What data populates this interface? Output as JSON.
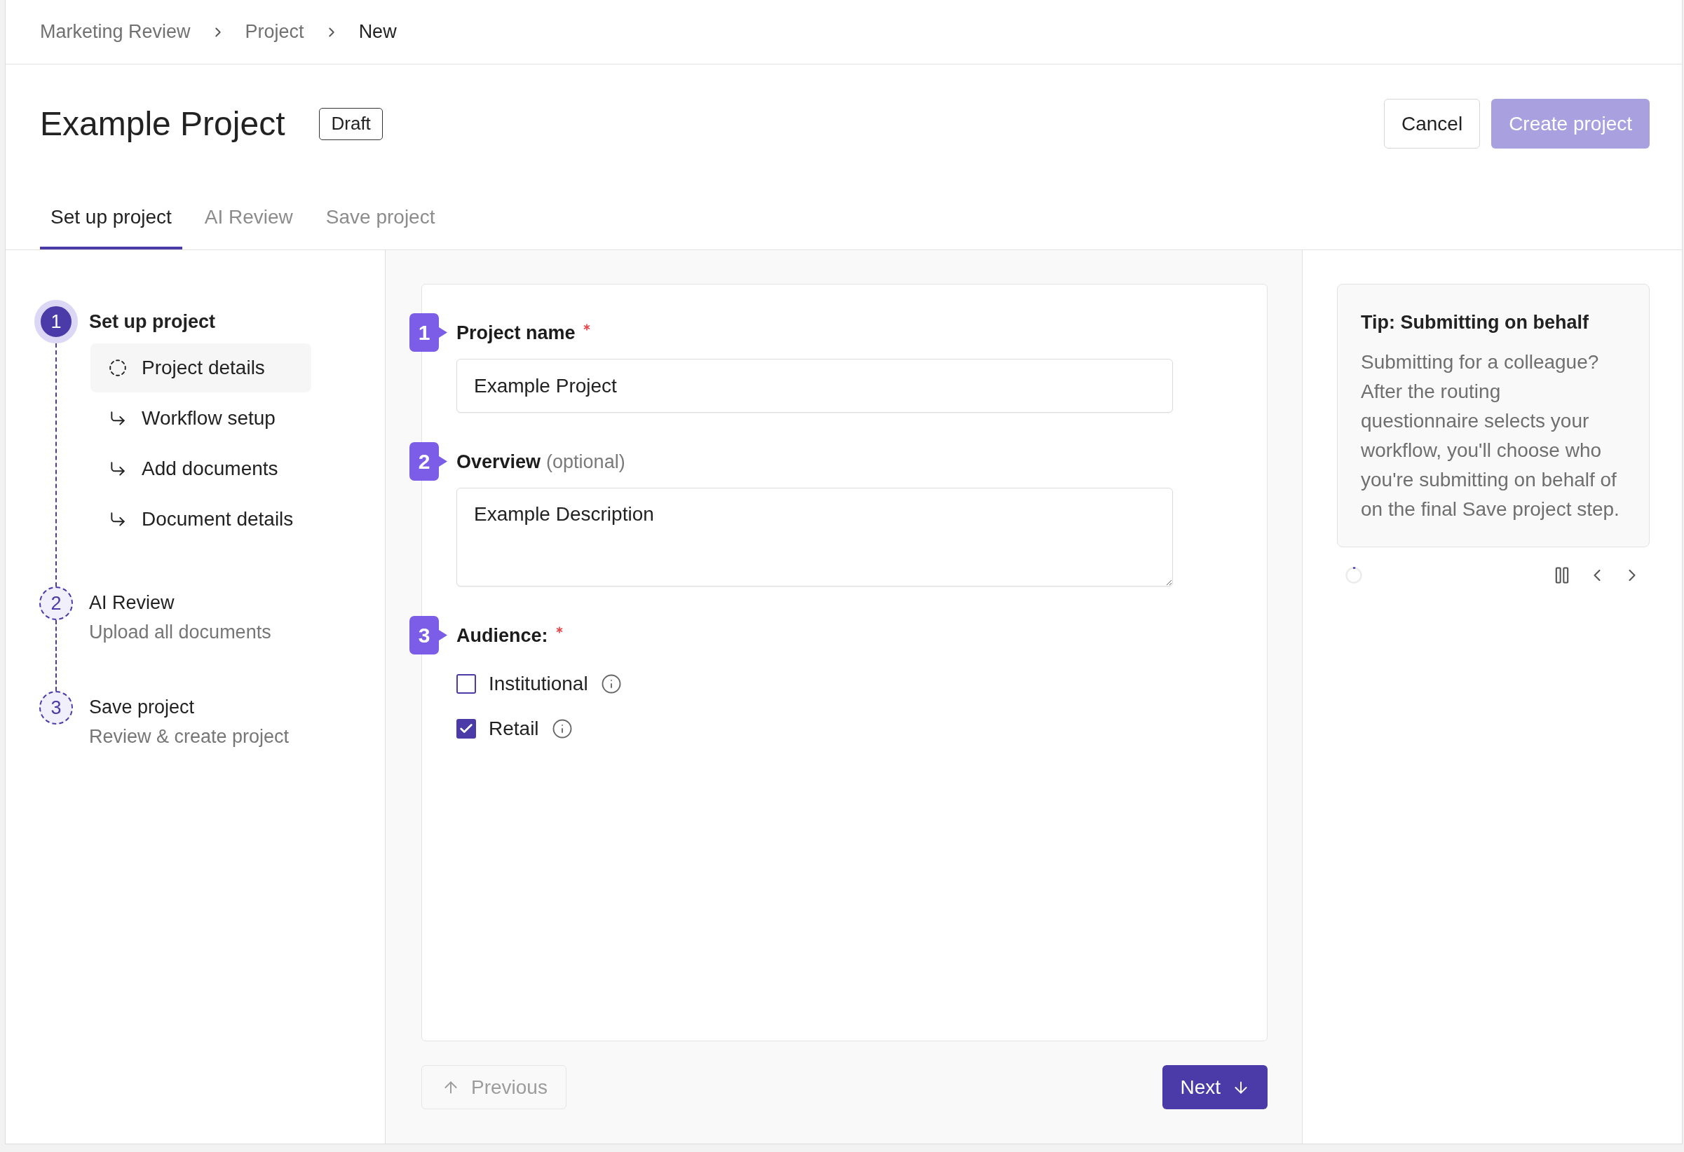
{
  "breadcrumb": [
    {
      "label": "Marketing Review",
      "current": false
    },
    {
      "label": "Project",
      "current": false
    },
    {
      "label": "New",
      "current": true
    }
  ],
  "header": {
    "title": "Example Project",
    "status_badge": "Draft",
    "buttons": [
      {
        "label": "Cancel",
        "kind": "secondary",
        "disabled": false
      },
      {
        "label": "Create project",
        "kind": "primary",
        "disabled": true
      }
    ]
  },
  "tabs": [
    {
      "label": "Set up project",
      "selected": true
    },
    {
      "label": "AI Review",
      "selected": false
    },
    {
      "label": "Save project",
      "selected": false
    }
  ],
  "steps": [
    {
      "number": "1",
      "title": "Set up project",
      "current": true,
      "substeps": [
        {
          "label": "Project details",
          "selected": true
        },
        {
          "label": "Workflow setup",
          "selected": false
        },
        {
          "label": "Add documents",
          "selected": false
        },
        {
          "label": "Document details",
          "selected": false
        }
      ]
    },
    {
      "number": "2",
      "title": "AI Review",
      "subtitle": "Upload all documents",
      "current": false
    },
    {
      "number": "3",
      "title": "Save project",
      "subtitle": "Review & create project",
      "current": false
    }
  ],
  "form": {
    "fields": [
      {
        "number": "1",
        "kind": "text",
        "label": "Project name",
        "required": true,
        "value": "Example Project"
      },
      {
        "number": "2",
        "kind": "textarea",
        "label": "Overview",
        "hint": "(optional)",
        "required": false,
        "value": "Example Description"
      },
      {
        "number": "3",
        "kind": "checkboxes",
        "label": "Audience:",
        "required": true,
        "options": [
          {
            "label": "Institutional",
            "checked": false
          },
          {
            "label": "Retail",
            "checked": true
          }
        ]
      }
    ],
    "buttons": [
      {
        "label": "Previous",
        "kind": "back",
        "disabled": true
      },
      {
        "label": "Next",
        "kind": "forward",
        "disabled": false
      }
    ]
  },
  "tip": {
    "title": "Tip: Submitting on behalf",
    "body": "Submitting for a colleague? After the routing questionnaire selects your workflow, you'll choose who you're submitting on behalf of on the final Save project step."
  }
}
